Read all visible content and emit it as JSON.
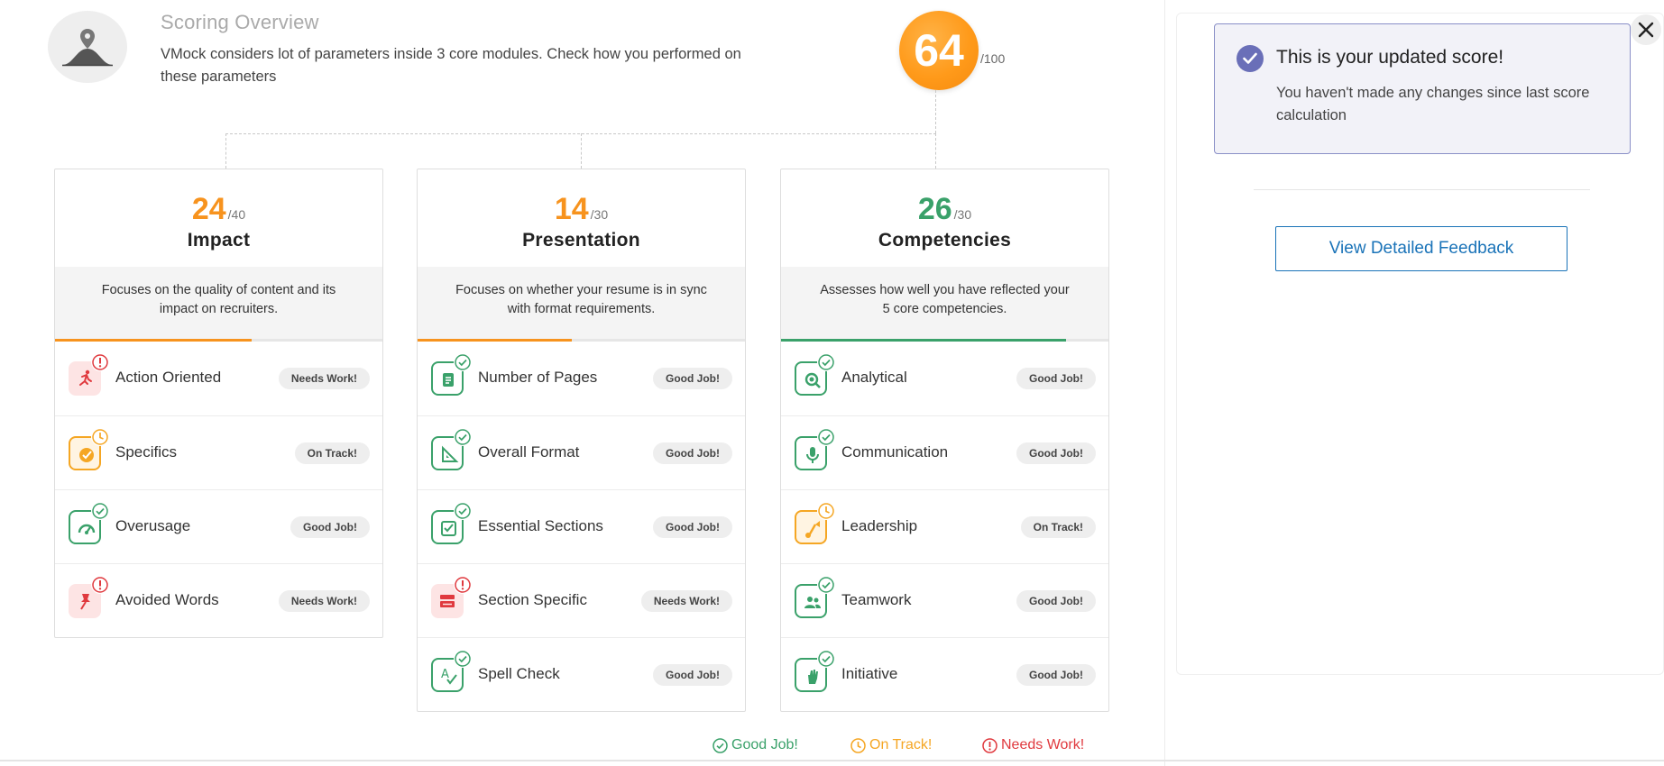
{
  "header": {
    "title": "Scoring Overview",
    "description": "VMock considers lot of parameters inside 3 core modules. Check how you performed on these parameters",
    "total_score": "64",
    "total_max": "/100",
    "logo_icon": "bell-curve-pin-icon"
  },
  "modules": [
    {
      "score": "24",
      "max": "/40",
      "name": "Impact",
      "description": "Focuses on the quality of content and its impact on recruiters.",
      "accent": "#f7931e",
      "progress": 0.6,
      "items": [
        {
          "label": "Action Oriented",
          "status": "Needs Work!",
          "status_type": "needs-work",
          "icon": "running-person-icon"
        },
        {
          "label": "Specifics",
          "status": "On Track!",
          "status_type": "on-track",
          "icon": "target-icon"
        },
        {
          "label": "Overusage",
          "status": "Good Job!",
          "status_type": "good-job",
          "icon": "gauge-icon"
        },
        {
          "label": "Avoided Words",
          "status": "Needs Work!",
          "status_type": "needs-work",
          "icon": "pushpin-icon"
        }
      ]
    },
    {
      "score": "14",
      "max": "/30",
      "name": "Presentation",
      "description": "Focuses on whether your resume is in sync with format requirements.",
      "accent": "#f7931e",
      "progress": 0.47,
      "items": [
        {
          "label": "Number of Pages",
          "status": "Good Job!",
          "status_type": "good-job",
          "icon": "pages-icon"
        },
        {
          "label": "Overall Format",
          "status": "Good Job!",
          "status_type": "good-job",
          "icon": "set-square-icon"
        },
        {
          "label": "Essential Sections",
          "status": "Good Job!",
          "status_type": "good-job",
          "icon": "checklist-icon"
        },
        {
          "label": "Section Specific",
          "status": "Needs Work!",
          "status_type": "needs-work",
          "icon": "sections-icon"
        },
        {
          "label": "Spell Check",
          "status": "Good Job!",
          "status_type": "good-job",
          "icon": "spell-check-icon"
        }
      ]
    },
    {
      "score": "26",
      "max": "/30",
      "name": "Competencies",
      "description": "Assesses how well you have reflected your 5 core competencies.",
      "accent": "#3aa16a",
      "progress": 0.87,
      "items": [
        {
          "label": "Analytical",
          "status": "Good Job!",
          "status_type": "good-job",
          "icon": "magnifier-icon"
        },
        {
          "label": "Communication",
          "status": "Good Job!",
          "status_type": "good-job",
          "icon": "microphone-icon"
        },
        {
          "label": "Leadership",
          "status": "On Track!",
          "status_type": "on-track",
          "icon": "flag-icon"
        },
        {
          "label": "Teamwork",
          "status": "Good Job!",
          "status_type": "good-job",
          "icon": "team-icon"
        },
        {
          "label": "Initiative",
          "status": "Good Job!",
          "status_type": "good-job",
          "icon": "raised-hand-icon"
        }
      ]
    }
  ],
  "legend": {
    "good_job": "Good Job!",
    "on_track": "On Track!",
    "needs_work": "Needs Work!"
  },
  "colors": {
    "good_job": "#3aa16a",
    "on_track": "#f5a623",
    "needs_work": "#e0393e",
    "score_orange": "#f7931e",
    "score_green": "#3aa16a"
  },
  "notice": {
    "title": "This is your updated score!",
    "message": "You haven't made any changes since last score calculation"
  },
  "actions": {
    "feedback_button": "View Detailed Feedback"
  }
}
